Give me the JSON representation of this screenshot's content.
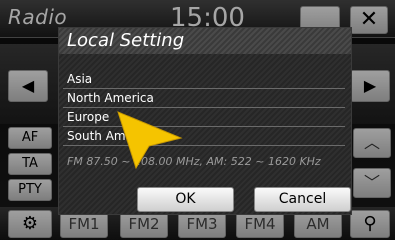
{
  "app": {
    "title": "Radio",
    "clock": "15:00",
    "close_label": "✕",
    "nav_prev": "◀",
    "nav_next": "▶"
  },
  "side_buttons": [
    {
      "label": "AF"
    },
    {
      "label": "TA"
    },
    {
      "label": "PTY"
    }
  ],
  "scroll": {
    "up": "︿",
    "down": "﹀"
  },
  "bottom": {
    "settings_icon": "⚙",
    "bands": [
      "FM1",
      "FM2",
      "FM3",
      "FM4",
      "AM"
    ],
    "search_icon": "⚲"
  },
  "dialog": {
    "title": "Local Setting",
    "regions": [
      "Asia",
      "North America",
      "Europe",
      "South America"
    ],
    "info": "FM 87.50 ~ 108.00 MHz, AM: 522 ~ 1620 KHz",
    "ok_label": "OK",
    "cancel_label": "Cancel"
  },
  "colors": {
    "accent_pointer": "#f5c400",
    "dialog_bg": "#2b2b2b"
  }
}
